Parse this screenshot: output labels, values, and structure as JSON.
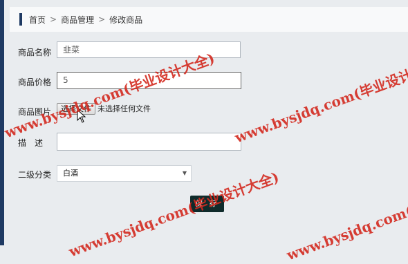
{
  "breadcrumb": {
    "home": "首页",
    "section": "商品管理",
    "current": "修改商品",
    "separator": ">"
  },
  "form": {
    "name_label": "商品名称",
    "name_value": "韭菜",
    "price_label": "商品价格",
    "price_value": "5",
    "image_label": "商品图片",
    "file_button": "选择文件",
    "file_status": "未选择任何文件",
    "description_label": "描　述",
    "description_value": "",
    "category_label": "二级分类",
    "category_value": "白酒",
    "save_button": "保 存"
  },
  "watermark": {
    "text": "www.bysjdq.com(毕业设计大全)"
  },
  "colors": {
    "watermark": "#d32a1f",
    "save_button_bg": "#0f2b2b",
    "sidebar_edge": "#1f3a63"
  }
}
